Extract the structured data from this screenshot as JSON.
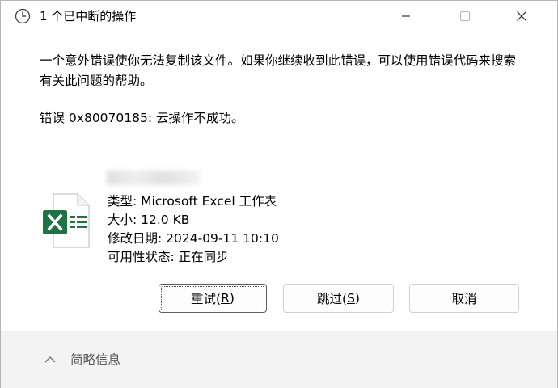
{
  "window": {
    "title": "1 个已中断的操作"
  },
  "message": {
    "text": "一个意外错误使你无法复制该文件。如果你继续收到此错误，可以使用错误代码来搜索有关此问题的帮助。",
    "error_line": "错误 0x80070185: 云操作不成功。"
  },
  "file": {
    "icon": "excel-file-icon",
    "type_line": "类型: Microsoft Excel 工作表",
    "size_line": "大小: 12.0 KB",
    "modified_line": "修改日期: 2024-09-11 10:10",
    "status_line": "可用性状态: 正在同步"
  },
  "buttons": {
    "retry_label": "重试(",
    "retry_key": "R",
    "retry_close": ")",
    "skip_label": "跳过(",
    "skip_key": "S",
    "skip_close": ")",
    "cancel_label": "取消"
  },
  "footer": {
    "toggle_label": "简略信息"
  },
  "colors": {
    "excel_green": "#1f7244",
    "footer_bg": "#f3f3f3",
    "button_border": "#d1d1d1"
  }
}
